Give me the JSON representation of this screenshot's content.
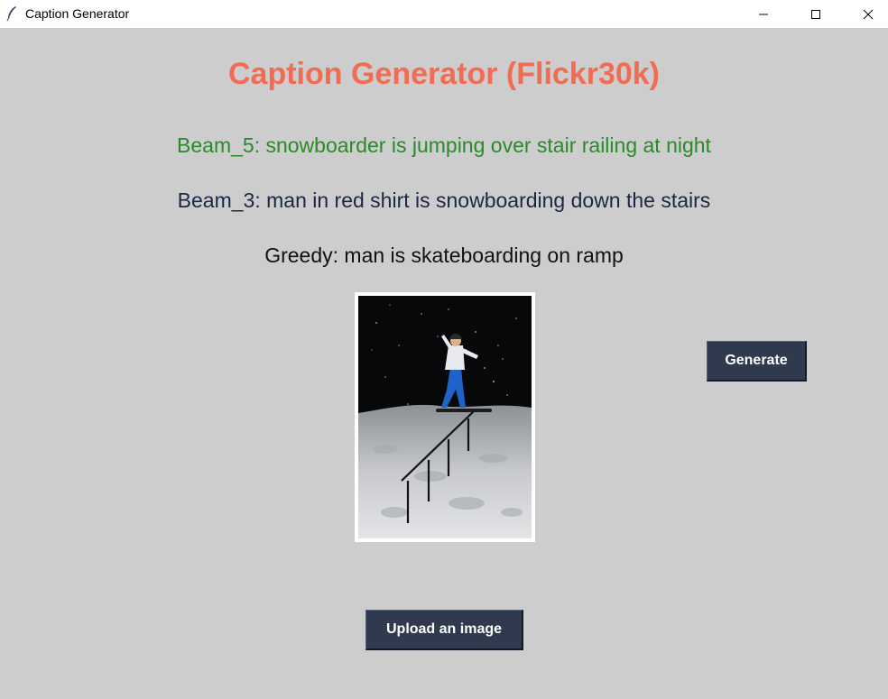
{
  "window": {
    "title": "Caption Generator",
    "icon": "feather-icon",
    "controls": [
      "minimize-icon",
      "maximize-icon",
      "close-icon"
    ]
  },
  "heading": "Caption Generator (Flickr30k)",
  "captions": {
    "beam5": "Beam_5: snowboarder is jumping over stair railing at night",
    "beam3": "Beam_3: man in red shirt is snowboarding down the stairs",
    "greedy": "Greedy: man is skateboarding on ramp"
  },
  "buttons": {
    "generate": "Generate",
    "upload": "Upload an image"
  },
  "colors": {
    "background": "#cdcdcd",
    "heading": "#f26b52",
    "beam5": "#2a8a2a",
    "beam3": "#1c2745",
    "greedy": "#111111",
    "button": "#2f3a4f"
  }
}
